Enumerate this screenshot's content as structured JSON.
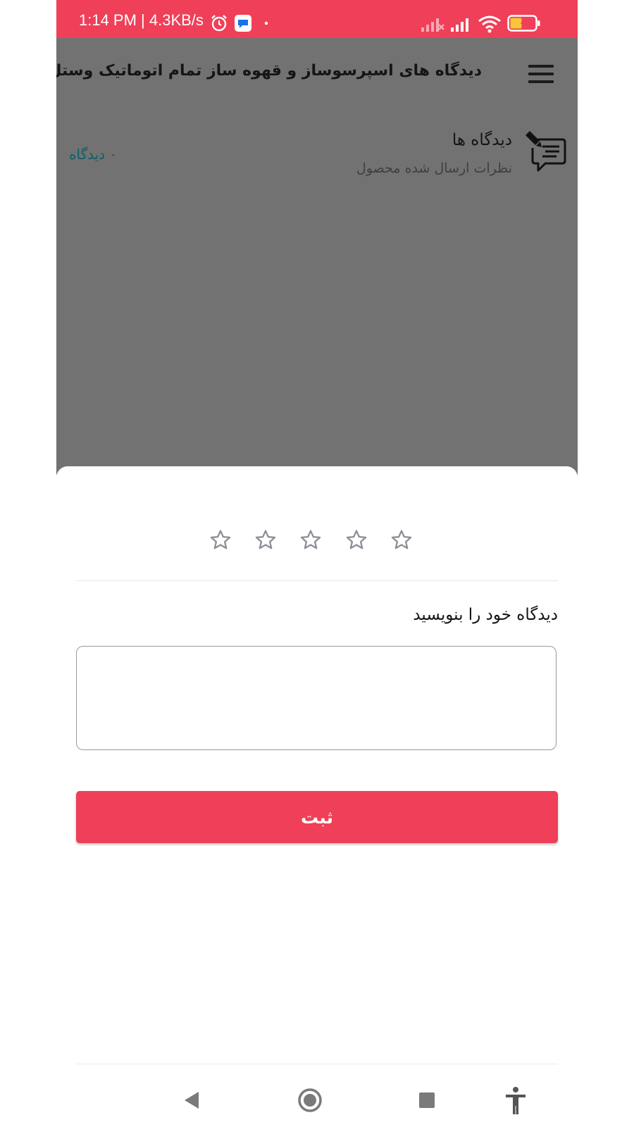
{
  "status_bar": {
    "time_text": "1:14 PM | 4.3KB/s",
    "battery_level": "40",
    "icons": [
      "alarm-icon",
      "messages-icon",
      "dot-icon",
      "no-signal-icon",
      "signal-icon",
      "wifi-icon",
      "battery-icon"
    ]
  },
  "app_bar": {
    "title": "دیدگاه های  اسپرسوساز و قهوه ساز تمام اتوماتیک وستل",
    "menu_icon": "hamburger-menu-icon"
  },
  "comments_header": {
    "heading": "دیدگاه ها",
    "subtitle": "نظرات ارسال شده محصول",
    "count_label": "۰ دیدگاه",
    "icon": "comment-edit-icon"
  },
  "sheet": {
    "rating": {
      "max": 5,
      "selected": 0
    },
    "write_label": "دیدگاه خود را بنویسید",
    "comment_value": "",
    "submit_label": "ثبت"
  },
  "nav_bar": {
    "items": [
      "back-icon",
      "home-icon",
      "recents-icon",
      "accessibility-icon"
    ]
  },
  "colors": {
    "accent": "#f03f58",
    "scrim": "#727272",
    "count_text": "#0f5f66"
  }
}
